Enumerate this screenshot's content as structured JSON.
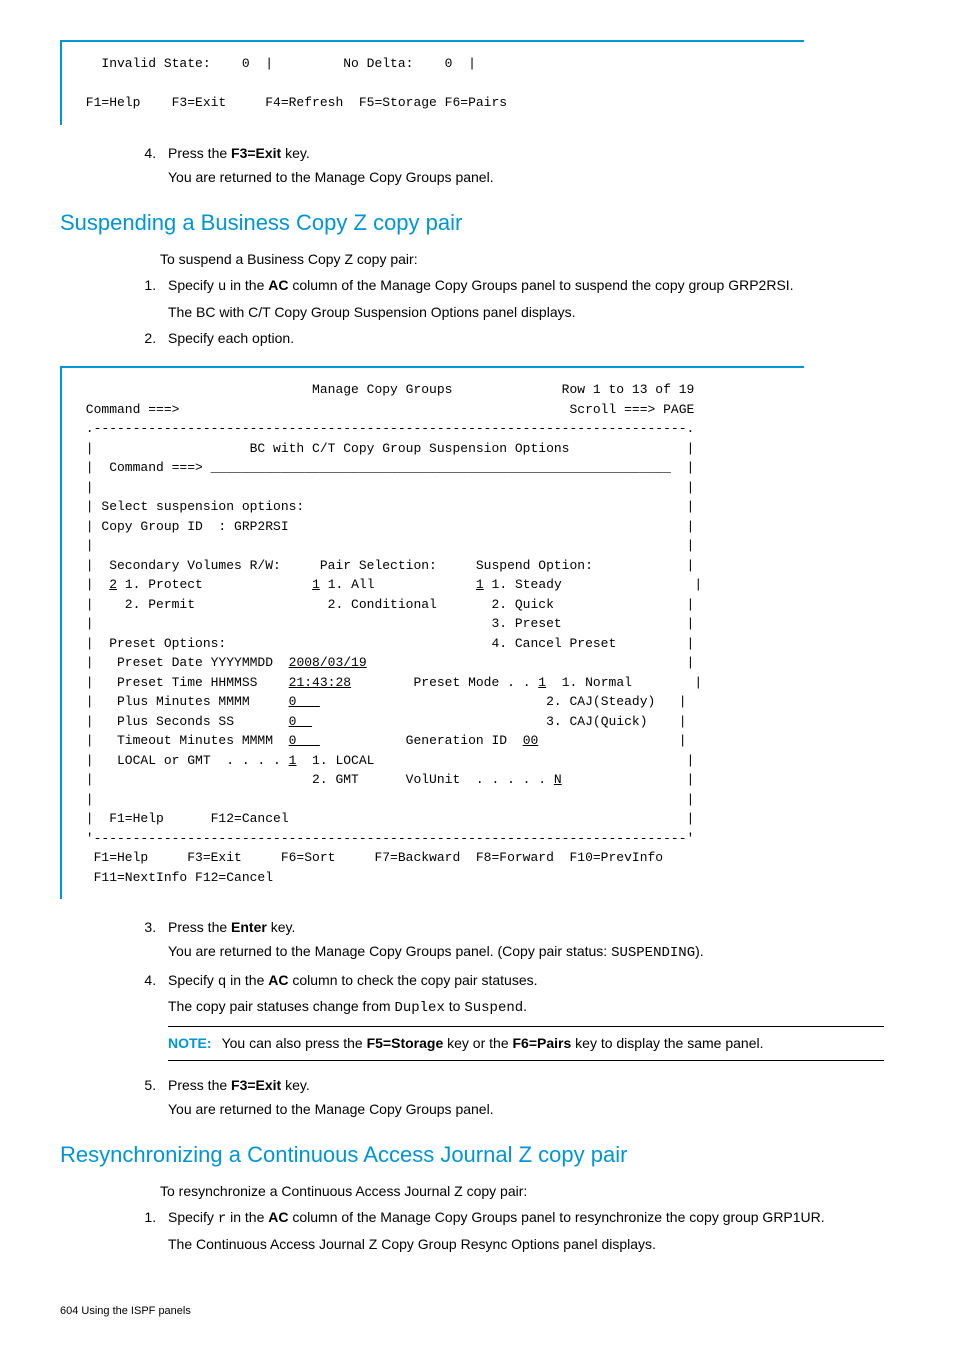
{
  "panel1": {
    "line1": "   Invalid State:    0  |         No Delta:    0  |",
    "line2": "",
    "line3": " F1=Help    F3=Exit     F4=Refresh  F5=Storage F6=Pairs"
  },
  "step4a": {
    "num": "4.",
    "text_pre": "Press the ",
    "bold": "F3=Exit",
    "text_post": " key.",
    "sub": "You are returned to the Manage Copy Groups panel."
  },
  "heading1": "Suspending a Business Copy Z copy pair",
  "intro1": "To suspend a Business Copy Z copy pair:",
  "s1_step1": {
    "pre": "Specify ",
    "mono": "u",
    "mid": " in the ",
    "bold": "AC",
    "post": " column of the Manage Copy Groups panel to suspend the copy group GRP2RSI.",
    "sub": "The BC with C/T Copy Group Suspension Options panel displays."
  },
  "s1_step2": "Specify each option.",
  "panel2": [
    "                              Manage Copy Groups              Row 1 to 13 of 19",
    " Command ===>                                                  Scroll ===> PAGE",
    " .----------------------------------------------------------------------------.",
    " |                    BC with C/T Copy Group Suspension Options               |",
    " |  Command ===> ___________________________________________________________  |",
    " |                                                                            |",
    " | Select suspension options:                                                 |",
    " | Copy Group ID  : GRP2RSI                                                   |",
    " |                                                                            |",
    " |  Secondary Volumes R/W:     Pair Selection:     Suspend Option:            |",
    " |  <u>2</u> 1. Protect              <u>1</u> 1. All             <u>1</u> 1. Steady                 |",
    " |    2. Permit                 2. Conditional       2. Quick                 |",
    " |                                                   3. Preset                |",
    " |  Preset Options:                                  4. Cancel Preset         |",
    " |   Preset Date YYYYMMDD  <u>2008/03/19</u>                                         |",
    " |   Preset Time HHMMSS    <u>21:43:28</u>        Preset Mode . . <u>1</u>  1. Normal        |",
    " |   Plus Minutes MMMM     <u>0   </u>                             2. CAJ(Steady)   |",
    " |   Plus Seconds SS       <u>0  </u>                              3. CAJ(Quick)    |",
    " |   Timeout Minutes MMMM  <u>0   </u>           Generation ID  <u>00</u>                  |",
    " |   LOCAL or GMT  . . . . <u>1</u>  1. LOCAL                                        |",
    " |                            2. GMT      VolUnit  . . . . . <u>N</u>                |",
    " |                                                                            |",
    " |  F1=Help      F12=Cancel                                                   |",
    " '----------------------------------------------------------------------------'",
    "  F1=Help     F3=Exit     F6=Sort     F7=Backward  F8=Forward  F10=PrevInfo",
    "  F11=NextInfo F12=Cancel"
  ],
  "s1_step3": {
    "pre": "Press the ",
    "bold": "Enter",
    "post": " key.",
    "sub_pre": "You are returned to the Manage Copy Groups panel. (Copy pair status: ",
    "sub_mono": "SUSPENDING",
    "sub_post": ")."
  },
  "s1_step4": {
    "pre": "Specify ",
    "mono": "q",
    "mid": " in the ",
    "bold": "AC",
    "post": " column to check the copy pair statuses.",
    "sub_pre": "The copy pair statuses change from ",
    "sub_mono1": "Duplex",
    "sub_mid": " to ",
    "sub_mono2": "Suspend",
    "sub_post": "."
  },
  "note": {
    "label": "NOTE:",
    "pre": "You can also press the ",
    "b1": "F5=Storage",
    "mid": " key or the ",
    "b2": "F6=Pairs",
    "post": " key to display the same panel."
  },
  "s1_step5": {
    "pre": "Press the ",
    "bold": "F3=Exit",
    "post": " key.",
    "sub": "You are returned to the Manage Copy Groups panel."
  },
  "heading2": "Resynchronizing a Continuous Access Journal Z copy pair",
  "intro2": "To resynchronize a Continuous Access Journal Z copy pair:",
  "s2_step1": {
    "pre": "Specify ",
    "mono": "r",
    "mid": " in the ",
    "bold": "AC",
    "post": " column of the Manage Copy Groups panel to resynchronize the copy group GRP1UR.",
    "sub": "The Continuous Access Journal Z Copy Group Resync Options panel displays."
  },
  "footer": "604   Using the ISPF panels"
}
